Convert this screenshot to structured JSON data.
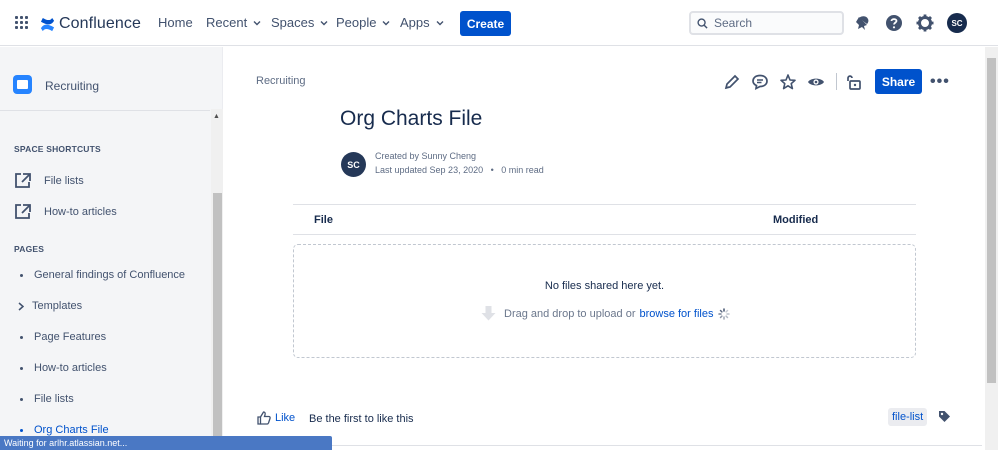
{
  "topbar": {
    "app_name": "Confluence",
    "nav": [
      {
        "label": "Home",
        "dropdown": false
      },
      {
        "label": "Recent",
        "dropdown": true
      },
      {
        "label": "Spaces",
        "dropdown": true
      },
      {
        "label": "People",
        "dropdown": true
      },
      {
        "label": "Apps",
        "dropdown": true
      }
    ],
    "create_label": "Create",
    "search_placeholder": "Search",
    "icons": [
      "notifications-icon",
      "help-icon",
      "settings-icon"
    ],
    "user_initials": "SC",
    "brand_color": "#0052cc"
  },
  "sidebar": {
    "space_name": "Recruiting",
    "shortcuts_heading": "SPACE SHORTCUTS",
    "shortcuts": [
      {
        "label": "File lists",
        "icon": "external-link-icon"
      },
      {
        "label": "How-to articles",
        "icon": "external-link-icon"
      }
    ],
    "pages_heading": "PAGES",
    "pages": [
      {
        "label": "General findings of Confluence",
        "marker": "bullet"
      },
      {
        "label": "Templates",
        "marker": "caret"
      },
      {
        "label": "Page Features",
        "marker": "bullet"
      },
      {
        "label": "How-to articles",
        "marker": "bullet"
      },
      {
        "label": "File lists",
        "marker": "bullet"
      },
      {
        "label": "Org Charts File",
        "marker": "bullet",
        "active": true
      }
    ]
  },
  "status_bar": "Waiting for arlhr.atlassian.net...",
  "page": {
    "breadcrumb": "Recruiting",
    "share_label": "Share",
    "more_label": "•••",
    "title": "Org Charts File",
    "author_initials": "SC",
    "created_by": "Created by Sunny Cheng",
    "last_updated": "Last updated Sep 23, 2020",
    "read_time": "0 min read",
    "table": {
      "columns": [
        "File",
        "Modified"
      ],
      "empty_message": "No files shared here yet.",
      "upload_text": "Drag and drop to upload or",
      "browse_link": "browse for files"
    },
    "like_label": "Like",
    "first_like": "Be the first to like this",
    "label": "file-list"
  }
}
